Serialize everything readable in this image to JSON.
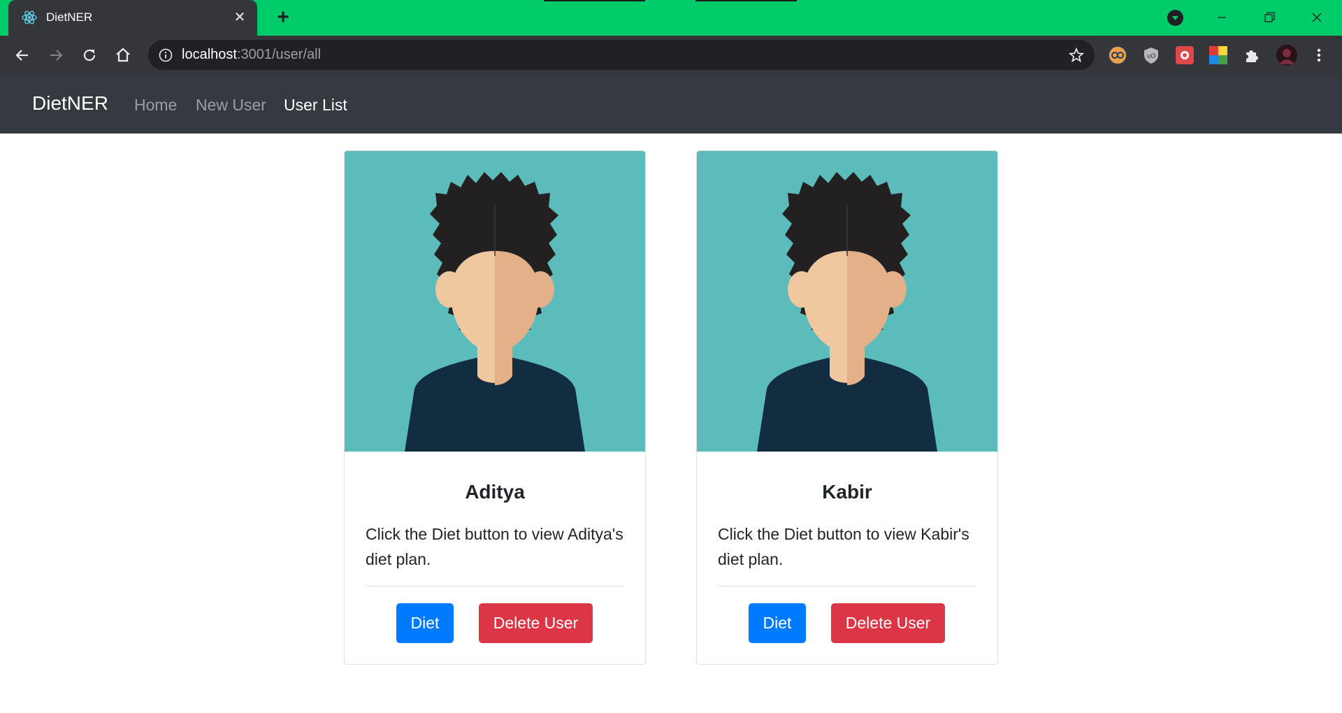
{
  "browser": {
    "tab_title": "DietNER",
    "tab_close": "✕",
    "new_tab": "+",
    "url_host": "localhost",
    "url_rest": ":3001/user/all"
  },
  "navbar": {
    "brand": "DietNER",
    "links": [
      {
        "label": "Home",
        "active": false
      },
      {
        "label": "New User",
        "active": false
      },
      {
        "label": "User List",
        "active": true
      }
    ]
  },
  "users": [
    {
      "name": "Aditya",
      "description": "Click the Diet button to view Aditya's diet plan.",
      "diet_label": "Diet",
      "delete_label": "Delete User"
    },
    {
      "name": "Kabir",
      "description": "Click the Diet button to view Kabir's diet plan.",
      "diet_label": "Diet",
      "delete_label": "Delete User"
    }
  ],
  "colors": {
    "titlebar": "#00cc6a",
    "navbar": "#343a40",
    "avatar_bg": "#5cbcbb",
    "primary": "#007bff",
    "danger": "#dc3545"
  },
  "icons": [
    "react-favicon-icon",
    "back-arrow-icon",
    "forward-arrow-icon",
    "reload-icon",
    "home-icon",
    "info-icon",
    "star-icon",
    "extensions-icon",
    "menu-dots-icon",
    "minimize-icon",
    "restore-icon",
    "close-window-icon",
    "avatar-illustration"
  ]
}
